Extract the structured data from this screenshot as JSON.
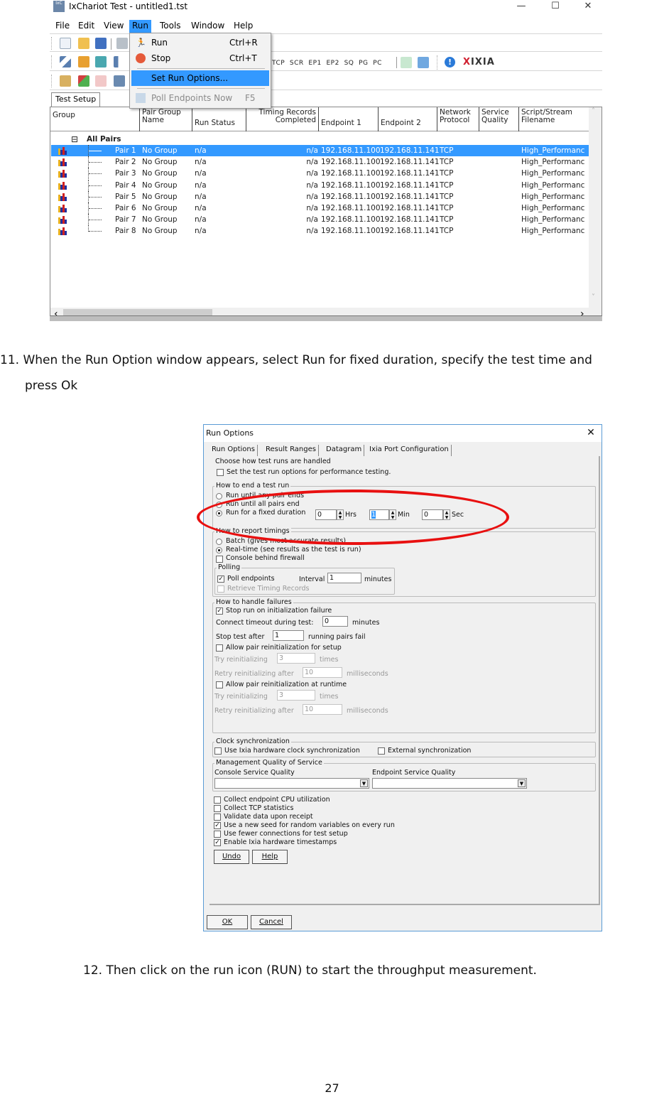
{
  "window": {
    "app_icon_text": "IxC",
    "title": "IxChariot Test - untitled1.tst",
    "controls": {
      "minimize": "—",
      "maximize": "☐",
      "close": "✕"
    },
    "menus": [
      {
        "label": "File",
        "accel": "F"
      },
      {
        "label": "Edit",
        "accel": "E"
      },
      {
        "label": "View",
        "accel": "V"
      },
      {
        "label": "Run",
        "accel": "R",
        "active": true
      },
      {
        "label": "Tools",
        "accel": "T"
      },
      {
        "label": "Window",
        "accel": "W"
      },
      {
        "label": "Help",
        "accel": "H"
      }
    ],
    "toolbar1_icons": [
      "new-file-icon",
      "open-folder-icon",
      "save-icon",
      "print-icon"
    ],
    "toolbar2_icons": [
      "pair-icon",
      "phone-pair-icon",
      "video-pair-icon",
      "multicast-icon"
    ],
    "toolbar2_text_buttons": [
      "TCP",
      "SCR",
      "EP1",
      "EP2",
      "SQ",
      "PG",
      "PC"
    ],
    "toolbar2_right_icons": [
      "import-icon",
      "export-icon",
      "info-icon"
    ],
    "brand_logo": "XIXIA",
    "toolbar3_icons": [
      "clapper-icon",
      "green-run-icon",
      "red-stop-icon",
      "network-icon"
    ],
    "run_menu": {
      "items": [
        {
          "label": "Run",
          "accel": "R",
          "shortcut": "Ctrl+R",
          "icon": "runner-icon",
          "state": "normal"
        },
        {
          "label": "Stop",
          "accel": "t",
          "shortcut": "Ctrl+T",
          "icon": "stop-icon",
          "state": "normal"
        },
        {
          "label": "Set Run Options...",
          "accel": "S",
          "shortcut": "",
          "icon": "",
          "state": "highlighted"
        },
        {
          "label": "Poll Endpoints Now",
          "accel": "P",
          "shortcut": "F5",
          "icon": "poll-icon",
          "state": "disabled"
        }
      ]
    },
    "tab": "Test Setup",
    "grid": {
      "columns": [
        {
          "line1": "",
          "line2": "Group"
        },
        {
          "line1": "Pair Group",
          "line2": "Name"
        },
        {
          "line1": "",
          "line2": "Run Status"
        },
        {
          "line1": "Timing Records",
          "line2": "Completed"
        },
        {
          "line1": "",
          "line2": "Endpoint 1"
        },
        {
          "line1": "",
          "line2": "Endpoint 2"
        },
        {
          "line1": "Network",
          "line2": "Protocol"
        },
        {
          "line1": "Service",
          "line2": "Quality"
        },
        {
          "line1": "Script/Stream",
          "line2": "Filename"
        }
      ],
      "root_label": "All Pairs",
      "root_toggle": "⊟",
      "rows": [
        {
          "pair": "Pair 1",
          "group": "No Group",
          "status": "n/a",
          "records": "n/a",
          "ep1": "192.168.11.100",
          "ep2": "192.168.11.141",
          "protocol": "TCP",
          "qos": "",
          "script": "High_Performanc",
          "selected": true
        },
        {
          "pair": "Pair 2",
          "group": "No Group",
          "status": "n/a",
          "records": "n/a",
          "ep1": "192.168.11.100",
          "ep2": "192.168.11.141",
          "protocol": "TCP",
          "qos": "",
          "script": "High_Performanc",
          "selected": false
        },
        {
          "pair": "Pair 3",
          "group": "No Group",
          "status": "n/a",
          "records": "n/a",
          "ep1": "192.168.11.100",
          "ep2": "192.168.11.141",
          "protocol": "TCP",
          "qos": "",
          "script": "High_Performanc",
          "selected": false
        },
        {
          "pair": "Pair 4",
          "group": "No Group",
          "status": "n/a",
          "records": "n/a",
          "ep1": "192.168.11.100",
          "ep2": "192.168.11.141",
          "protocol": "TCP",
          "qos": "",
          "script": "High_Performanc",
          "selected": false
        },
        {
          "pair": "Pair 5",
          "group": "No Group",
          "status": "n/a",
          "records": "n/a",
          "ep1": "192.168.11.100",
          "ep2": "192.168.11.141",
          "protocol": "TCP",
          "qos": "",
          "script": "High_Performanc",
          "selected": false
        },
        {
          "pair": "Pair 6",
          "group": "No Group",
          "status": "n/a",
          "records": "n/a",
          "ep1": "192.168.11.100",
          "ep2": "192.168.11.141",
          "protocol": "TCP",
          "qos": "",
          "script": "High_Performanc",
          "selected": false
        },
        {
          "pair": "Pair 7",
          "group": "No Group",
          "status": "n/a",
          "records": "n/a",
          "ep1": "192.168.11.100",
          "ep2": "192.168.11.141",
          "protocol": "TCP",
          "qos": "",
          "script": "High_Performanc",
          "selected": false
        },
        {
          "pair": "Pair 8",
          "group": "No Group",
          "status": "n/a",
          "records": "n/a",
          "ep1": "192.168.11.100",
          "ep2": "192.168.11.141",
          "protocol": "TCP",
          "qos": "",
          "script": "High_Performanc",
          "selected": false
        }
      ],
      "scroll": {
        "up": "˄",
        "down": "˅",
        "left": "‹",
        "right": "›"
      }
    }
  },
  "step11": {
    "number": "11.",
    "line1": "When the Run Option window appears, select Run for fixed duration, specify the test time and",
    "line2": "press Ok"
  },
  "dialog": {
    "title": "Run Options",
    "close": "✕",
    "tabs": [
      "Run Options",
      "Result Ranges",
      "Datagram",
      "Ixia Port Configuration"
    ],
    "active_tab": "Run Options",
    "heading": "Choose how test runs are handled",
    "perf_testing": {
      "label": "Set the test run options for performance testing.",
      "checked": false
    },
    "end_group": {
      "title": "How to end a test run",
      "options": [
        {
          "label": "Run until any pair ends",
          "selected": false
        },
        {
          "label": "Run until all pairs end",
          "selected": false
        },
        {
          "label": "Run for a fixed duration",
          "selected": true
        }
      ],
      "hours": "0",
      "hours_unit": "Hrs",
      "minutes": "1",
      "minutes_unit": "Min",
      "seconds": "0",
      "seconds_unit": "Sec"
    },
    "report_group": {
      "title": "How to report timings",
      "options": [
        {
          "label": "Batch (gives most accurate results)",
          "selected": false
        },
        {
          "label": "Real-time (see results as the test is run)",
          "selected": true
        }
      ],
      "firewall": {
        "label": "Console behind firewall",
        "checked": false
      },
      "polling": {
        "title": "Polling",
        "poll_endpoints": {
          "label": "Poll endpoints",
          "checked": true
        },
        "interval_label": "Interval",
        "interval": "1",
        "interval_unit": "minutes",
        "retrieve": {
          "label": "Retrieve Timing Records",
          "checked": false,
          "disabled": true
        }
      }
    },
    "failure_group": {
      "title": "How to handle failures",
      "stop_on_init": {
        "label": "Stop run on initialization failure",
        "checked": true
      },
      "connect_timeout_label": "Connect timeout during test:",
      "connect_timeout": "0",
      "connect_timeout_unit": "minutes",
      "stop_after_label": "Stop test after",
      "stop_after": "1",
      "stop_after_unit": "running pairs fail",
      "setup_reinit": {
        "label": "Allow pair reinitialization for setup",
        "checked": false
      },
      "setup_try_label": "Try reinitializing",
      "setup_try": "3",
      "setup_try_unit": "times",
      "setup_retry_label": "Retry reinitializing after",
      "setup_retry": "10",
      "setup_retry_unit": "milliseconds",
      "runtime_reinit": {
        "label": "Allow pair reinitialization at runtime",
        "checked": false
      },
      "runtime_try_label": "Try reinitializing",
      "runtime_try": "3",
      "runtime_try_unit": "times",
      "runtime_retry_label": "Retry reinitializing after",
      "runtime_retry": "10",
      "runtime_retry_unit": "milliseconds"
    },
    "clock_group": {
      "title": "Clock synchronization",
      "ixia_hw": {
        "label": "Use Ixia hardware clock synchronization",
        "checked": false
      },
      "external": {
        "label": "External synchronization",
        "checked": false
      }
    },
    "mgmt_group": {
      "title": "Management Quality of Service",
      "console_label": "Console Service Quality",
      "console_value": "",
      "endpoint_label": "Endpoint Service Quality",
      "endpoint_value": ""
    },
    "misc_options": [
      {
        "label": "Collect endpoint CPU utilization",
        "checked": false
      },
      {
        "label": "Collect TCP statistics",
        "checked": false
      },
      {
        "label": "Validate data upon receipt",
        "checked": false
      },
      {
        "label": "Use a new seed for random variables on every run",
        "checked": true
      },
      {
        "label": "Use fewer connections for test setup",
        "checked": false
      },
      {
        "label": "Enable Ixia hardware timestamps",
        "checked": true
      }
    ],
    "undo_button": "Undo",
    "help_button": "Help",
    "ok_button": "OK",
    "cancel_button": "Cancel",
    "annotation_color": "#e81010"
  },
  "step12": {
    "text": "12. Then click on the run icon (RUN) to start the throughput measurement."
  },
  "page_number": "27"
}
